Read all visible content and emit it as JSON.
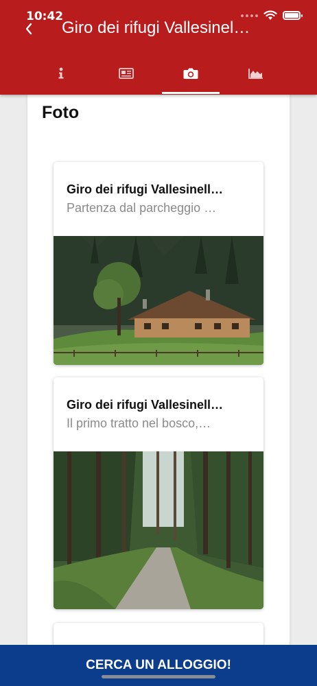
{
  "status_bar": {
    "time": "10:42"
  },
  "header": {
    "title": "Giro dei rifugi Vallesinel…",
    "tabs": [
      {
        "icon": "info-icon",
        "active": false
      },
      {
        "icon": "newspaper-icon",
        "active": false
      },
      {
        "icon": "camera-icon",
        "active": true
      },
      {
        "icon": "elevation-chart-icon",
        "active": false
      }
    ]
  },
  "main": {
    "section_title": "Foto",
    "cards": [
      {
        "title": "Giro dei rifugi Vallesinell…",
        "subtitle": "Partenza dal parcheggio …",
        "image": "mountain-hut-photo"
      },
      {
        "title": "Giro dei rifugi Vallesinell…",
        "subtitle": "Il primo tratto nel bosco,…",
        "image": "forest-path-photo"
      },
      {
        "title": "",
        "subtitle": "",
        "image": ""
      }
    ]
  },
  "footer": {
    "cta_label": "CERCA UN ALLOGGIO!"
  },
  "colors": {
    "header": "#b81c1c",
    "cta": "#0b3d8c",
    "background": "#ececec"
  }
}
